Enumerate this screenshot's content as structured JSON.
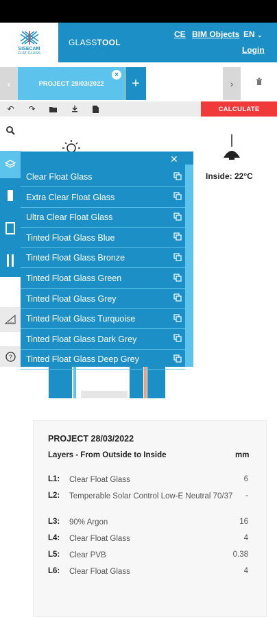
{
  "header": {
    "logo_line1": "SISECAM",
    "logo_line2": "FLAT GLASS",
    "brand_prefix": "GLASS",
    "brand_suffix": "TOOL",
    "links": {
      "ce": "CE",
      "bim": "BIM Objects",
      "lang": "EN",
      "login": "Login"
    }
  },
  "tabs": {
    "project_tab": "PROJECT 28/03/2022"
  },
  "toolbar": {
    "calculate": "CALCULATE",
    "icons": [
      "undo-icon",
      "redo-icon",
      "folder-icon",
      "download-icon",
      "document-icon"
    ]
  },
  "scene": {
    "inside_label": "Inside: 22°C"
  },
  "menu": {
    "items": [
      "Clear Float Glass",
      "Extra Clear Float Glass",
      "Ultra Clear Float Glass",
      "Tinted Float Glass Blue",
      "Tinted Float Glass Bronze",
      "Tinted Float Glass Green",
      "Tinted Float Glass Grey",
      "Tinted Float Glass Turquoise",
      "Tinted Float Glass Dark Grey",
      "Tinted Float Glass Deep Grey"
    ]
  },
  "summary": {
    "title": "PROJECT 28/03/2022",
    "heading": "Layers - From Outside to Inside",
    "unit": "mm",
    "layers": [
      {
        "label": "L1:",
        "name": "Clear Float Glass",
        "value": "6"
      },
      {
        "label": "L2:",
        "name": "Temperable Solar Control Low-E Neutral 70/37",
        "value": "-"
      },
      {
        "label": "L3:",
        "name": "90% Argon",
        "value": "16"
      },
      {
        "label": "L4:",
        "name": "Clear Float Glass",
        "value": "4"
      },
      {
        "label": "L5:",
        "name": "Clear PVB",
        "value": "0.38"
      },
      {
        "label": "L6:",
        "name": "Clear Float Glass",
        "value": "4"
      }
    ]
  },
  "colors": {
    "primary": "#1c90c6",
    "light": "#5bc3ec",
    "calculate": "#f03a3a"
  }
}
